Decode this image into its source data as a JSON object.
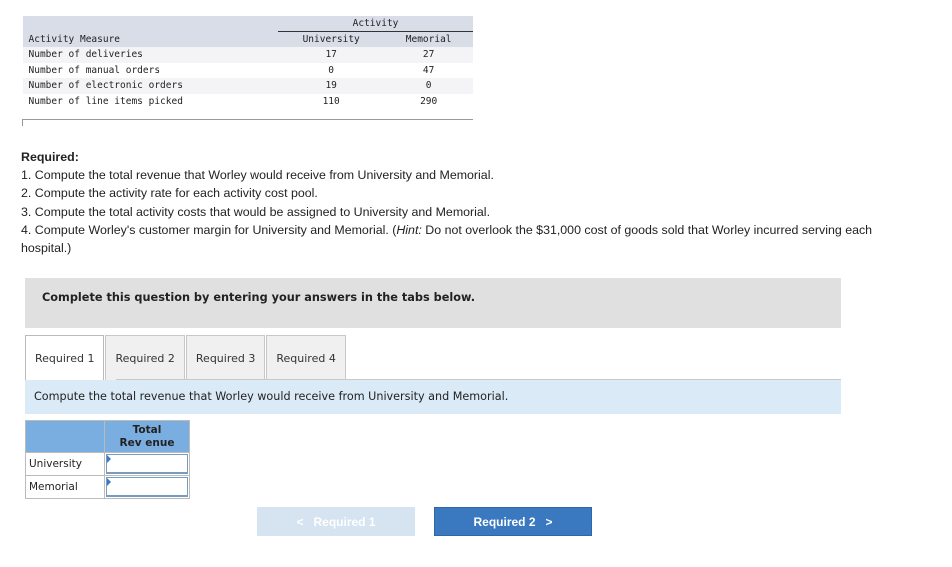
{
  "activity_table": {
    "group_header": "Activity",
    "measure_header": "Activity Measure",
    "columns": [
      "University",
      "Memorial"
    ],
    "rows": [
      {
        "measure": "Number of deliveries",
        "values": [
          "17",
          "27"
        ]
      },
      {
        "measure": "Number of manual orders",
        "values": [
          "0",
          "47"
        ]
      },
      {
        "measure": "Number of electronic orders",
        "values": [
          "19",
          "0"
        ]
      },
      {
        "measure": "Number of line items picked",
        "values": [
          "110",
          "290"
        ]
      }
    ]
  },
  "required": {
    "title": "Required:",
    "items": [
      "1. Compute the total revenue that Worley would receive from University and Memorial.",
      "2. Compute the activity rate for each activity cost pool.",
      "3. Compute the total activity costs that would be assigned to University and Memorial."
    ],
    "item4_prefix": "4. Compute Worley's customer margin for University and Memorial. (",
    "item4_hint": "Hint:",
    "item4_suffix": " Do not overlook the $31,000 cost of goods sold that Worley incurred serving each hospital.)"
  },
  "instruction": "Complete this question by entering your answers in the tabs below.",
  "tabs": [
    {
      "label": "Required 1",
      "active": true
    },
    {
      "label": "Required 2",
      "active": false
    },
    {
      "label": "Required 3",
      "active": false
    },
    {
      "label": "Required 4",
      "active": false
    }
  ],
  "prompt": "Compute the total revenue that Worley would receive from University and Memorial.",
  "answer_table": {
    "column_header_line1": "Total",
    "column_header_line2": "Rev enue",
    "rows": [
      {
        "label": "University",
        "value": ""
      },
      {
        "label": "Memorial",
        "value": ""
      }
    ]
  },
  "nav": {
    "prev_label": "Required 1",
    "next_label": "Required 2",
    "prev_icon": "chevron-left-icon",
    "next_icon": "chevron-right-icon"
  }
}
